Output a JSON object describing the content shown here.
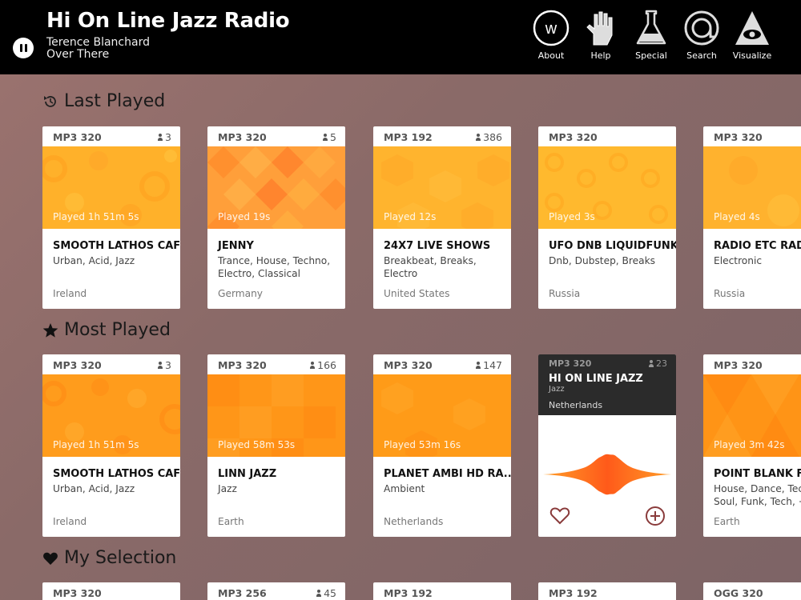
{
  "header": {
    "app_title": "Hi On Line Jazz Radio",
    "artist": "Terence Blanchard",
    "song": "Over There",
    "nav": [
      {
        "label": "About",
        "icon": "w-logo-icon"
      },
      {
        "label": "Help",
        "icon": "hand-icon"
      },
      {
        "label": "Special",
        "icon": "flask-icon"
      },
      {
        "label": "Search",
        "icon": "at-search-icon"
      },
      {
        "label": "Visualize",
        "icon": "eye-pyramid-icon"
      }
    ]
  },
  "sections": {
    "last_played": {
      "title": "Last Played",
      "cards": [
        {
          "format": "MP3 320",
          "listeners": "3",
          "played": "Played 1h 51m 5s",
          "name": "SMOOTH LATHOS CAFE",
          "genres": "Urban, Acid, Jazz",
          "country": "Ireland"
        },
        {
          "format": "MP3 320",
          "listeners": "5",
          "played": "Played 19s",
          "name": "JENNY",
          "genres": "Trance, House, Techno, Electro, Classical",
          "country": "Germany"
        },
        {
          "format": "MP3 192",
          "listeners": "386",
          "played": "Played 12s",
          "name": "24X7 LIVE SHOWS",
          "genres": "Breakbeat, Breaks, Electro",
          "country": "United States"
        },
        {
          "format": "MP3 320",
          "listeners": "",
          "played": "Played 3s",
          "name": "UFO DNB LIQUIDFUNK",
          "genres": "Dnb, Dubstep, Breaks",
          "country": "Russia"
        },
        {
          "format": "MP3 320",
          "listeners": "",
          "played": "Played 4s",
          "name": "RADIO ETC RADI",
          "genres": "Electronic",
          "country": "Russia"
        }
      ]
    },
    "most_played": {
      "title": "Most Played",
      "cards": [
        {
          "format": "MP3 320",
          "listeners": "3",
          "played": "Played 1h 51m 5s",
          "name": "SMOOTH LATHOS CAFE",
          "genres": "Urban, Acid, Jazz",
          "country": "Ireland"
        },
        {
          "format": "MP3 320",
          "listeners": "166",
          "played": "Played 58m 53s",
          "name": "LINN JAZZ",
          "genres": "Jazz",
          "country": "Earth"
        },
        {
          "format": "MP3 320",
          "listeners": "147",
          "played": "Played 53m 16s",
          "name": "PLANET AMBI HD RA..",
          "genres": "Ambient",
          "country": "Netherlands"
        },
        {
          "format": "MP3 320",
          "listeners": "23",
          "name": "HI ON LINE JAZZ",
          "genres": "Jazz",
          "country": "Netherlands"
        },
        {
          "format": "MP3 320",
          "listeners": "",
          "played": "Played 3m 42s",
          "name": "POINT BLANK FM",
          "genres": "House, Dance, Tech Soul, Funk, Tech, +",
          "country": "Earth"
        }
      ]
    },
    "my_selection": {
      "title": "My Selection",
      "cards": [
        {
          "format": "MP3 320",
          "listeners": ""
        },
        {
          "format": "MP3 256",
          "listeners": "45"
        },
        {
          "format": "MP3 192",
          "listeners": ""
        },
        {
          "format": "MP3 192",
          "listeners": ""
        },
        {
          "format": "OGG 320",
          "listeners": ""
        }
      ]
    }
  },
  "colors": {
    "header_bg": "#000000",
    "page_bg": "#8d6b69",
    "accent_orange": "#ff9a1f",
    "accent_yellow": "#ffb52c",
    "dark_card": "#2b2b2b"
  }
}
